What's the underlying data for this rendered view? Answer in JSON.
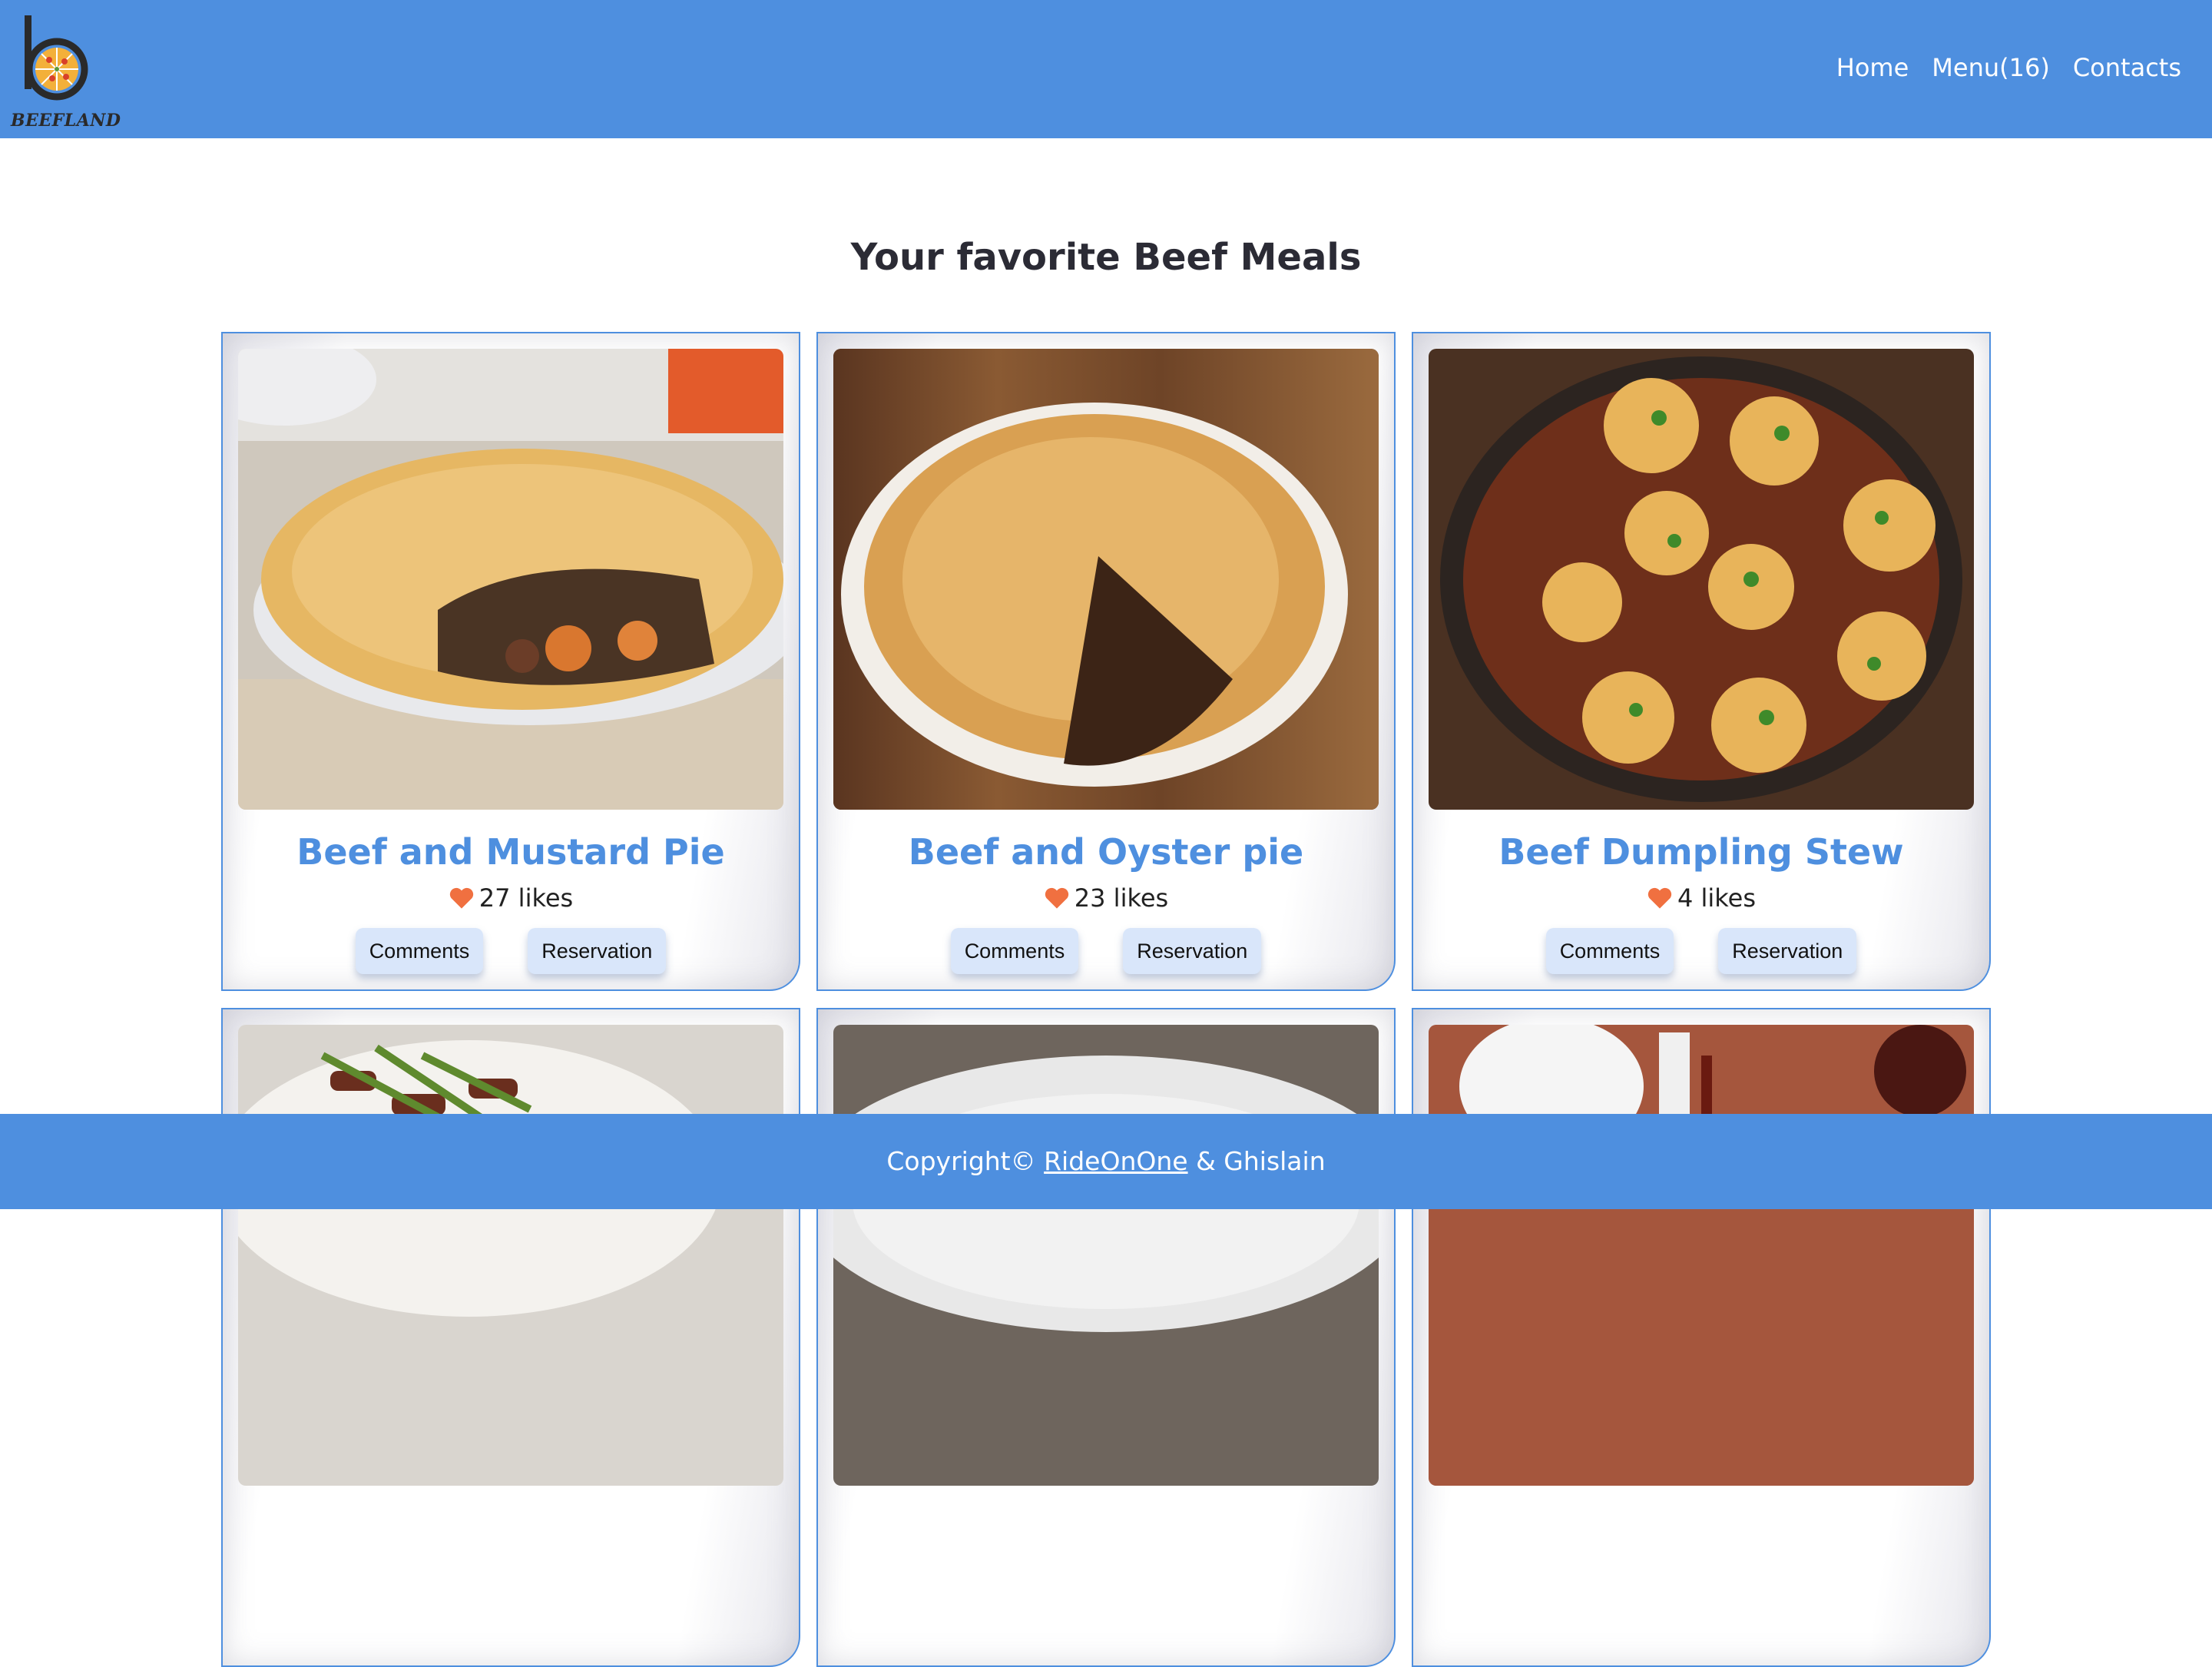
{
  "brand": {
    "logo_text": "BEEFLAND"
  },
  "nav": {
    "home": "Home",
    "menu": "Menu(16)",
    "contacts": "Contacts"
  },
  "main": {
    "title": "Your favorite Beef Meals",
    "cards": [
      {
        "title": "Beef and Mustard Pie",
        "likes": "27 likes",
        "comments_label": "Comments",
        "reservation_label": "Reservation",
        "image": "beef-and-mustard-pie-photo"
      },
      {
        "title": "Beef and Oyster pie",
        "likes": "23 likes",
        "comments_label": "Comments",
        "reservation_label": "Reservation",
        "image": "beef-and-oyster-pie-photo"
      },
      {
        "title": "Beef Dumpling Stew",
        "likes": "4 likes",
        "comments_label": "Comments",
        "reservation_label": "Reservation",
        "image": "beef-dumpling-stew-photo"
      },
      {
        "image": "beef-asparagus-stir-fry-photo"
      },
      {
        "image": "beef-plate-photo"
      },
      {
        "image": "beef-sauce-and-wine-photo"
      }
    ]
  },
  "footer": {
    "prefix": "Copyright©",
    "link": "RideOnOne",
    "suffix": "& Ghislain"
  },
  "colors": {
    "primary": "#4e8fdf",
    "heart": "#f07040",
    "button_bg": "#d9e6fa"
  }
}
